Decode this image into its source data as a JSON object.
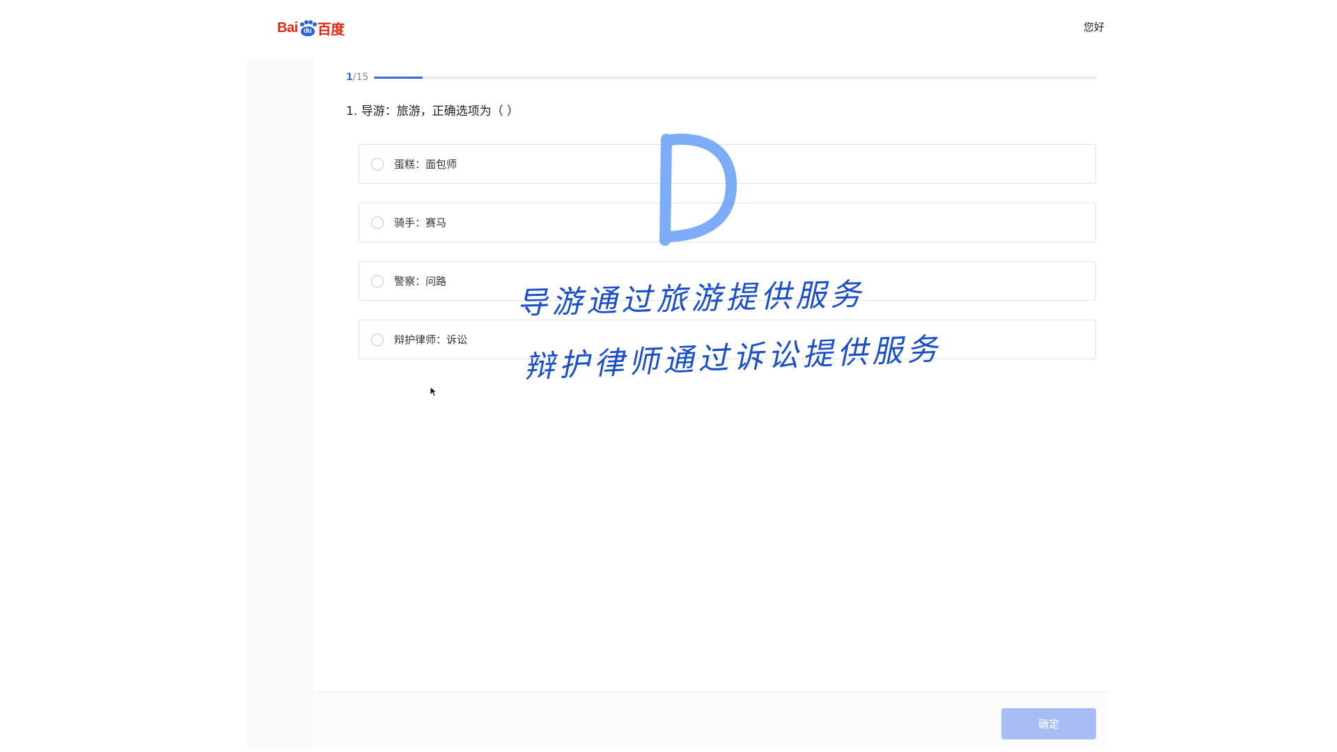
{
  "header": {
    "logo_text_left": "Bai",
    "logo_text_paw": "du",
    "logo_text_right": "百度",
    "greeting": "您好"
  },
  "quiz": {
    "progress_current": "1",
    "progress_total": "/15",
    "progress_fraction": 0.067,
    "question": "1. 导游：旅游，正确选项为（ ）",
    "options": [
      {
        "label": "蛋糕：面包师"
      },
      {
        "label": "骑手：赛马"
      },
      {
        "label": "警察：问路"
      },
      {
        "label": "辩护律师：诉讼"
      }
    ],
    "confirm_label": "确定"
  },
  "annotation": {
    "answer_letter": "D",
    "line1": "导游通过旅游提供服务",
    "line2": "辩护律师通过诉讼提供服务",
    "ink_color": "#1a4fc9",
    "answer_color": "#6fa3f7"
  },
  "colors": {
    "accent": "#3b68d9",
    "button_disabled": "#a8bdf4",
    "brand_red": "#de2910",
    "brand_blue": "#2d62d8"
  }
}
